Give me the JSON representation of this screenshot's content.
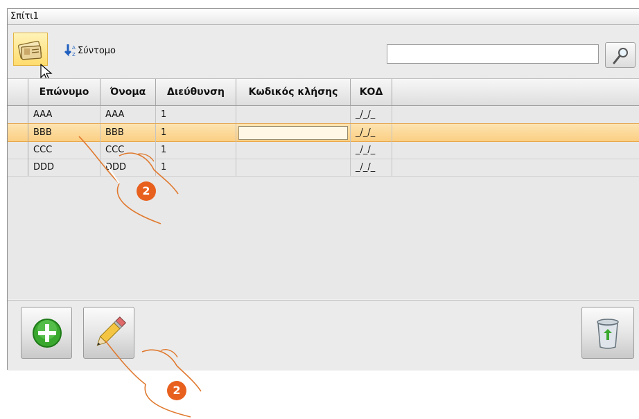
{
  "window": {
    "title": "Σπίτι1"
  },
  "toolbar": {
    "vcard_icon": "address-card-icon",
    "sort_icon": "sort-az-icon",
    "sort_label": "Σύντομο",
    "search_value": "",
    "search_icon": "magnifier-icon"
  },
  "grid": {
    "columns": [
      "Επώνυμο",
      "Όνομα",
      "Διεύθυνση",
      "Κωδικός κλήσης",
      "ΚΟΔ"
    ],
    "rows": [
      {
        "surname": "AAA",
        "name": "AAA",
        "address": "1",
        "call_code": "",
        "kod": "_/_/_"
      },
      {
        "surname": "BBB",
        "name": "BBB",
        "address": "1",
        "call_code": "",
        "kod": "_/_/_"
      },
      {
        "surname": "CCC",
        "name": "CCC",
        "address": "1",
        "call_code": "",
        "kod": "_/_/_"
      },
      {
        "surname": "DDD",
        "name": "DDD",
        "address": "1",
        "call_code": "",
        "kod": "_/_/_"
      }
    ],
    "selected_row": "BBB"
  },
  "bottom": {
    "add_icon": "plus-circle-icon",
    "edit_icon": "pencil-icon",
    "delete_icon": "recycle-bin-icon"
  },
  "callouts": [
    "2",
    "2"
  ],
  "colors": {
    "selection": "#fbcf84",
    "accent": "#e8601e",
    "add_green": "#3aa82f"
  }
}
